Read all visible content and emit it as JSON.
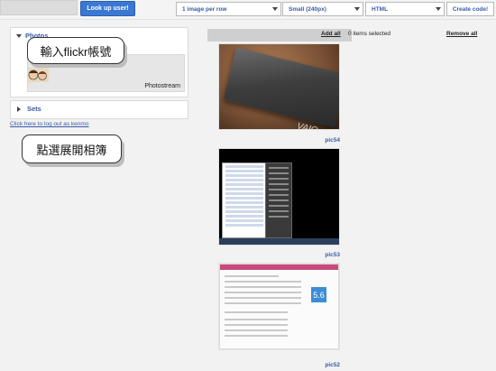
{
  "toolbar": {
    "lookup_button": "Look up user!",
    "layout_select": "1 image per row",
    "size_select": "Small (240px)",
    "format_select": "HTML",
    "create_button": "Create code!"
  },
  "left_panel": {
    "photos_section_label": "Photos",
    "photostream_label": "Photostream",
    "sets_label": "Sets",
    "logout_link": "Click here to log out as kenmo"
  },
  "callouts": {
    "enter_account": "輸入flickr帳號",
    "expand_album": "點選展開相簿"
  },
  "selection_bar": {
    "add_all": "Add all",
    "count": "0 items selected",
    "remove_all": "Remove all"
  },
  "photos": [
    {
      "caption": "pic54"
    },
    {
      "caption": "pic53"
    },
    {
      "caption": "pic52"
    }
  ],
  "screenshot_score": "5.6",
  "colors": {
    "accent_blue": "#3a78d4",
    "link_blue": "#3a5ba8"
  }
}
